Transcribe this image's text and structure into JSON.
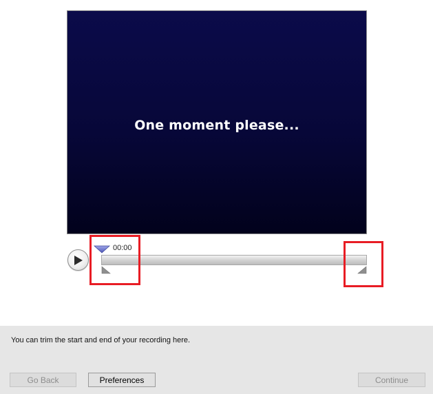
{
  "preview": {
    "message": "One moment please...",
    "background_color": "#070738"
  },
  "player": {
    "play_icon": "play-icon",
    "current_time": "00:00"
  },
  "trim": {
    "start_handle_icon": "trim-start-handle-icon",
    "end_handle_icon": "trim-end-handle-icon",
    "highlight_color": "#e81c24"
  },
  "footer": {
    "instruction": "You can trim the start and end of your recording here.",
    "back_label": "Go Back",
    "preferences_label": "Preferences",
    "continue_label": "Continue"
  }
}
